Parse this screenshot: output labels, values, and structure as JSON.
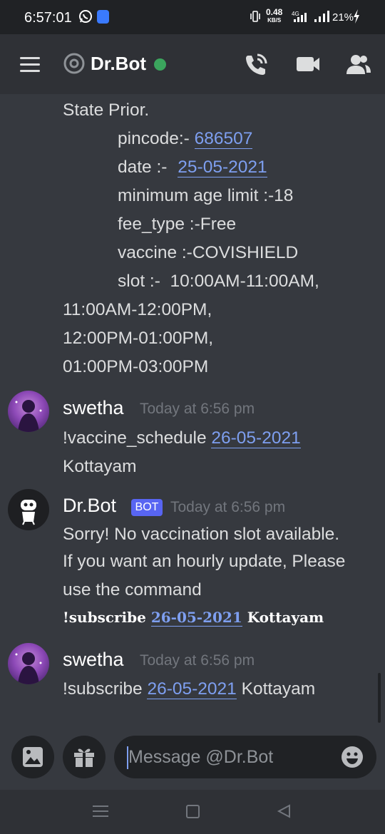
{
  "status_bar": {
    "time": "6:57:01",
    "speed_value": "0.48",
    "speed_unit": "KB/S",
    "network": "4G",
    "battery": "21%"
  },
  "header": {
    "title": "Dr.Bot",
    "status_color": "#3ba55d",
    "icons": [
      "menu-icon",
      "at-icon",
      "call-icon",
      "video-icon",
      "members-icon"
    ]
  },
  "messages": {
    "prev": {
      "line1": "State Prior.",
      "pincode_label": "pincode:-",
      "pincode_value": "686507",
      "date_label": "date :-",
      "date_value": "25-05-2021",
      "min_age": "minimum age limit :-18",
      "fee_type": "fee_type :-Free",
      "vaccine": "vaccine :-COVISHIELD",
      "slot": "slot :-  10:00AM-11:00AM,",
      "slot2": "11:00AM-12:00PM,",
      "slot3": "12:00PM-01:00PM,",
      "slot4": "01:00PM-03:00PM"
    },
    "msg1": {
      "author": "swetha",
      "timestamp": "Today at 6:56 pm",
      "command": "!vaccine_schedule",
      "date_link": "26-05-2021",
      "line2": "Kottayam"
    },
    "msg2": {
      "author": "Dr.Bot",
      "badge": "BOT",
      "timestamp": "Today at 6:56 pm",
      "line1": "Sorry! No vaccination slot available.",
      "line2": "If you want an hourly update, Please",
      "line3": "use the command",
      "cmd_bold": "!subscribe",
      "cmd_date": "26-05-2021",
      "cmd_city": "Kottayam"
    },
    "msg3": {
      "author": "swetha",
      "timestamp": "Today at 6:56 pm",
      "command": "!subscribe",
      "date_link": "26-05-2021",
      "city": "Kottayam"
    }
  },
  "input": {
    "placeholder": "Message @Dr.Bot",
    "buttons": [
      "image-icon",
      "gift-icon",
      "emoji-icon"
    ]
  },
  "colors": {
    "background": "#36393f",
    "header": "#2f3136",
    "link": "#7e9ff0",
    "bot_badge": "#5865f2"
  }
}
